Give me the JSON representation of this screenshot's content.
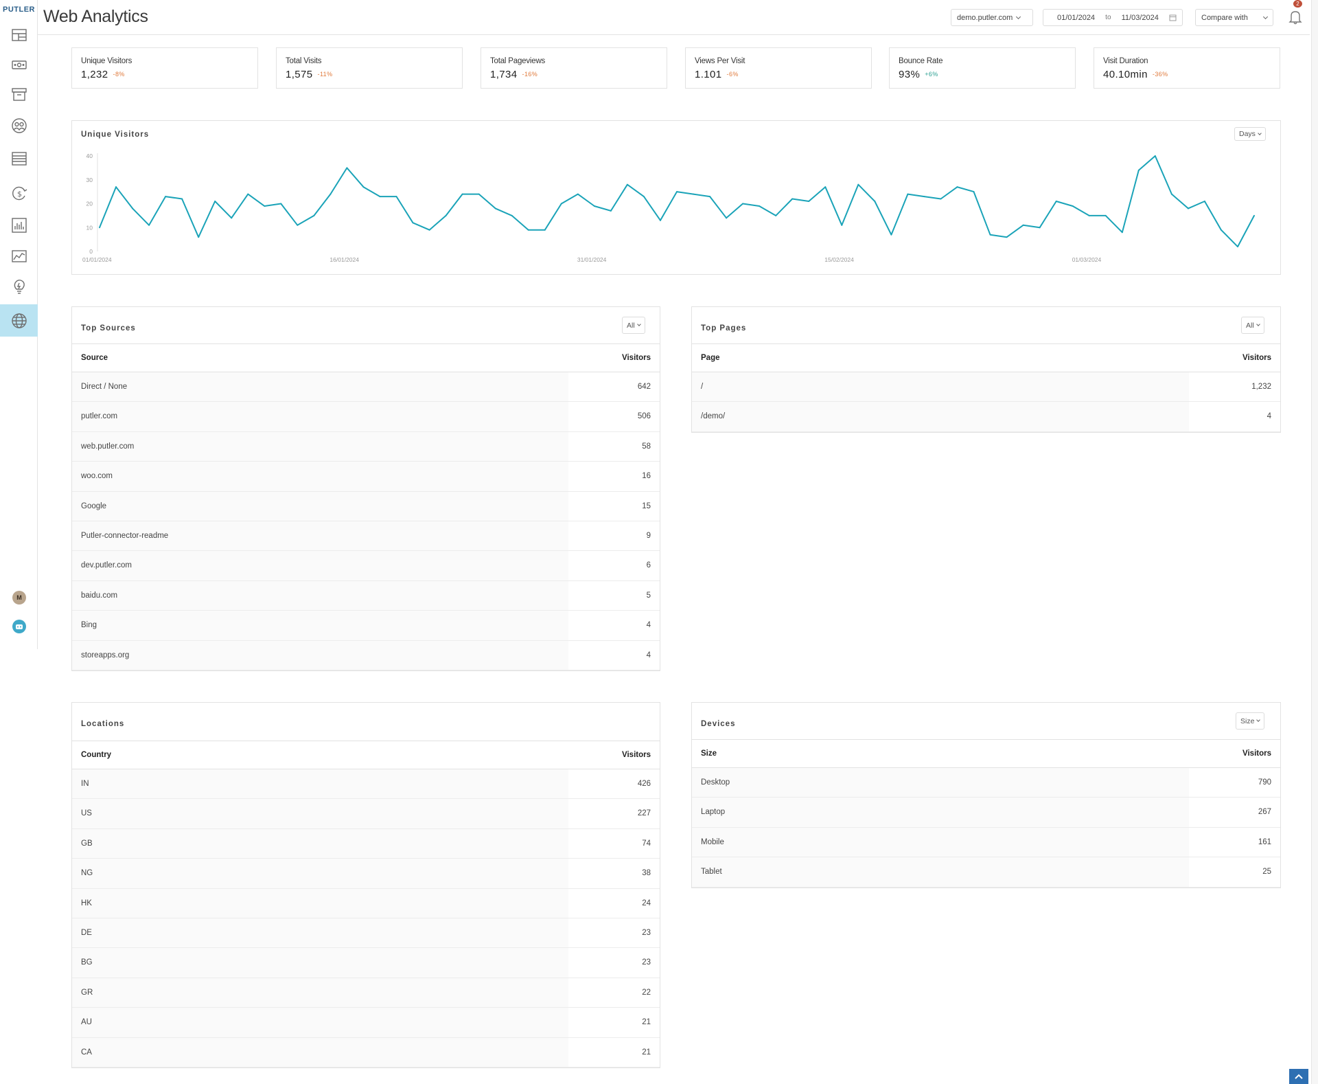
{
  "app": {
    "logo": "PUTLER"
  },
  "header": {
    "title": "Web Analytics",
    "site_select": "demo.putler.com",
    "date_from": "01/01/2024",
    "date_to_label": "to",
    "date_to": "11/03/2024",
    "compare_label": "Compare with",
    "notification_count": "2"
  },
  "sidebar": {
    "items": [
      {
        "icon": "dashboard-icon"
      },
      {
        "icon": "sales-icon"
      },
      {
        "icon": "products-icon"
      },
      {
        "icon": "customers-icon"
      },
      {
        "icon": "transactions-icon"
      },
      {
        "icon": "subscriptions-icon"
      },
      {
        "icon": "audience-icon"
      },
      {
        "icon": "forecast-icon"
      },
      {
        "icon": "insights-icon"
      },
      {
        "icon": "web-analytics-icon",
        "active": true
      }
    ],
    "user_initial": "M"
  },
  "kpis": [
    {
      "label": "Unique Visitors",
      "value": "1,232",
      "change": "-8%",
      "trend": "neg"
    },
    {
      "label": "Total Visits",
      "value": "1,575",
      "change": "-11%",
      "trend": "neg"
    },
    {
      "label": "Total Pageviews",
      "value": "1,734",
      "change": "-16%",
      "trend": "neg"
    },
    {
      "label": "Views Per Visit",
      "value": "1.101",
      "change": "-6%",
      "trend": "neg"
    },
    {
      "label": "Bounce Rate",
      "value": "93%",
      "change": "+6%",
      "trend": "pos"
    },
    {
      "label": "Visit Duration",
      "value": "40.10min",
      "change": "-36%",
      "trend": "neg"
    }
  ],
  "chart": {
    "title": "Unique Visitors",
    "granularity": "Days"
  },
  "chart_data": {
    "type": "line",
    "ylim": [
      0,
      40
    ],
    "yticks": [
      "0",
      "10",
      "20",
      "30",
      "40"
    ],
    "xticks": [
      "01/01/2024",
      "16/01/2024",
      "31/01/2024",
      "15/02/2024",
      "01/03/2024"
    ],
    "color": "#1aa3b8",
    "series": [
      {
        "values": [
          10,
          27,
          18,
          11,
          23,
          22,
          6,
          21,
          14,
          24,
          19,
          20,
          11,
          15,
          24,
          35,
          27,
          23,
          23,
          12,
          9,
          15,
          24,
          24,
          18,
          15,
          9,
          9,
          20,
          24,
          19,
          17,
          28,
          23,
          13,
          25,
          24,
          23,
          14,
          20,
          19,
          15,
          22,
          21,
          27,
          11,
          28,
          21,
          7,
          24,
          23,
          22,
          27,
          25,
          7,
          6,
          11,
          10,
          21,
          19,
          15,
          15,
          8,
          34,
          40,
          24,
          18,
          21,
          9,
          2,
          15
        ]
      }
    ]
  },
  "top_sources": {
    "title": "Top Sources",
    "filter": "All",
    "col_left": "Source",
    "col_right": "Visitors",
    "rows": [
      {
        "name": "Direct / None",
        "value": "642"
      },
      {
        "name": "putler.com",
        "value": "506"
      },
      {
        "name": "web.putler.com",
        "value": "58"
      },
      {
        "name": "woo.com",
        "value": "16"
      },
      {
        "name": "Google",
        "value": "15"
      },
      {
        "name": "Putler-connector-readme",
        "value": "9"
      },
      {
        "name": "dev.putler.com",
        "value": "6"
      },
      {
        "name": "baidu.com",
        "value": "5"
      },
      {
        "name": "Bing",
        "value": "4"
      },
      {
        "name": "storeapps.org",
        "value": "4"
      }
    ]
  },
  "top_pages": {
    "title": "Top Pages",
    "filter": "All",
    "col_left": "Page",
    "col_right": "Visitors",
    "rows": [
      {
        "name": "/",
        "value": "1,232"
      },
      {
        "name": "/demo/",
        "value": "4"
      }
    ]
  },
  "locations": {
    "title": "Locations",
    "col_left": "Country",
    "col_right": "Visitors",
    "rows": [
      {
        "name": "IN",
        "value": "426"
      },
      {
        "name": "US",
        "value": "227"
      },
      {
        "name": "GB",
        "value": "74"
      },
      {
        "name": "NG",
        "value": "38"
      },
      {
        "name": "HK",
        "value": "24"
      },
      {
        "name": "DE",
        "value": "23"
      },
      {
        "name": "BG",
        "value": "23"
      },
      {
        "name": "GR",
        "value": "22"
      },
      {
        "name": "AU",
        "value": "21"
      },
      {
        "name": "CA",
        "value": "21"
      }
    ]
  },
  "devices": {
    "title": "Devices",
    "filter": "Size",
    "col_left": "Size",
    "col_right": "Visitors",
    "rows": [
      {
        "name": "Desktop",
        "value": "790"
      },
      {
        "name": "Laptop",
        "value": "267"
      },
      {
        "name": "Mobile",
        "value": "161"
      },
      {
        "name": "Tablet",
        "value": "25"
      }
    ]
  }
}
